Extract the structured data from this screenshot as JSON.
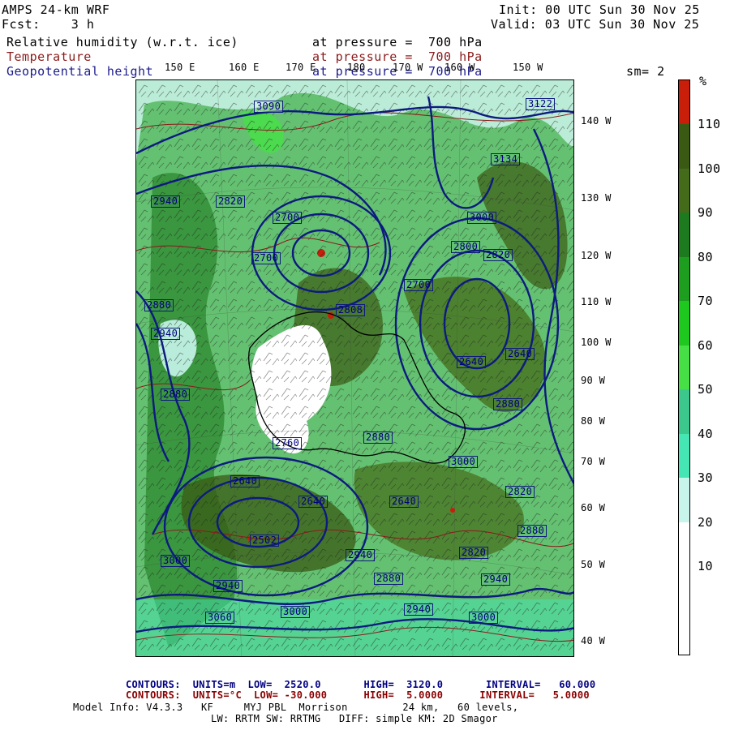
{
  "header": {
    "model": "AMPS 24-km WRF",
    "forecast": "Fcst:    3 h",
    "init": "Init: 00 UTC Sun 30 Nov 25",
    "valid": "Valid: 03 UTC Sun 30 Nov 25",
    "sm": "sm= 2"
  },
  "fields": [
    {
      "name": "Relative humidity (w.r.t. ice)",
      "level": "at pressure =  700 hPa",
      "color": "#000000"
    },
    {
      "name": "Temperature",
      "level": "at pressure =  700 hPa",
      "color": "#8b1a1a"
    },
    {
      "name": "Geopotential height",
      "level": "at pressure =  700 hPa",
      "color": "#1c1c8c"
    }
  ],
  "longitude_labels": [
    "150 E",
    "160 E",
    "170 E",
    "180",
    "170 W",
    "160 W",
    "150 W"
  ],
  "latitude_labels": [
    "140 W",
    "130 W",
    "120 W",
    "110 W",
    "100 W",
    "90 W",
    "80 W",
    "70 W",
    "60 W",
    "50 W",
    "40 W"
  ],
  "map_labels": [
    {
      "text": "3090"
    },
    {
      "text": "2940"
    },
    {
      "text": "2820"
    },
    {
      "text": "2700"
    },
    {
      "text": "2700"
    },
    {
      "text": "2800"
    },
    {
      "text": "3000"
    },
    {
      "text": "2808"
    },
    {
      "text": "2760"
    },
    {
      "text": "2640"
    },
    {
      "text": "2640"
    },
    {
      "text": "2640"
    },
    {
      "text": "2502"
    },
    {
      "text": "2940"
    },
    {
      "text": "3060"
    },
    {
      "text": "3000"
    },
    {
      "text": "2940"
    },
    {
      "text": "3000"
    },
    {
      "text": "2820"
    },
    {
      "text": "2880"
    },
    {
      "text": "2640"
    },
    {
      "text": "3134"
    },
    {
      "text": "3122"
    },
    {
      "text": "2700"
    },
    {
      "text": "2820"
    },
    {
      "text": "2880"
    },
    {
      "text": "2940"
    },
    {
      "text": "2820"
    },
    {
      "text": "2880"
    },
    {
      "text": "2880"
    },
    {
      "text": "3000"
    },
    {
      "text": "2940"
    },
    {
      "text": "2880"
    },
    {
      "text": "2940"
    },
    {
      "text": "3000"
    },
    {
      "text": "2880"
    },
    {
      "text": "2640"
    }
  ],
  "colorbar": {
    "unit": "%",
    "labels": [
      "110",
      "100",
      "90",
      "80",
      "70",
      "60",
      "50",
      "40",
      "30",
      "20",
      "10"
    ],
    "colors": [
      "#c81e0a",
      "#3a5a14",
      "#446b1a",
      "#1e7a1e",
      "#1e9e1e",
      "#1ec81e",
      "#46e046",
      "#3cc88c",
      "#46e6b4",
      "#c8f5eb",
      "#ffffff",
      "#ffffff",
      "#ffffff"
    ]
  },
  "footer": {
    "contours1": "CONTOURS:  UNITS=m  LOW=  2520.0       HIGH=  3120.0       INTERVAL=   60.000",
    "contours2": "CONTOURS:  UNITS=°C  LOW= -30.000      HIGH=  5.0000      INTERVAL=   5.0000",
    "model_info": "Model Info: V4.3.3   KF     MYJ PBL  Morrison         24 km,   60 levels,",
    "model_info2": "LW: RRTM SW: RRTMG   DIFF: simple KM: 2D Smagor"
  }
}
